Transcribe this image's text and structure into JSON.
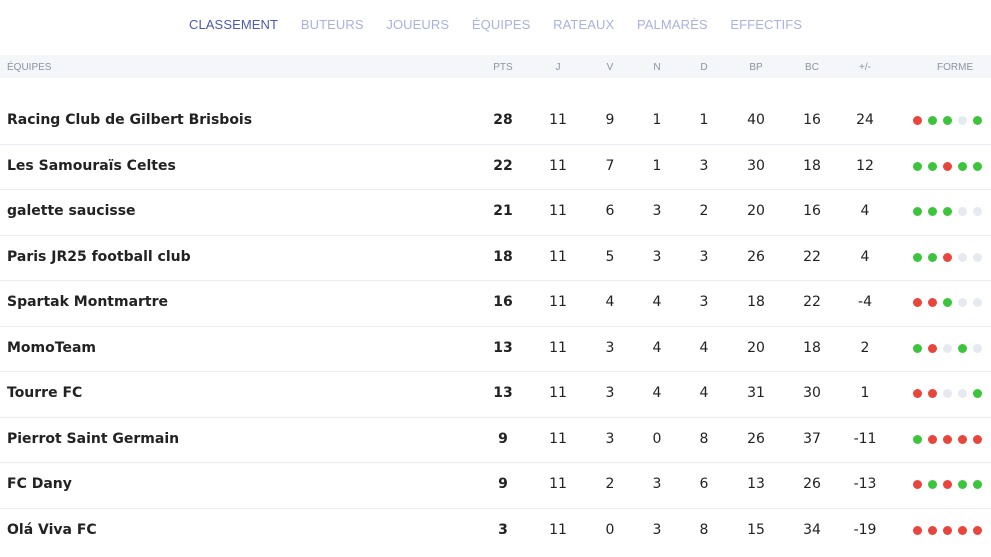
{
  "tabs": [
    "CLASSEMENT",
    "BUTEURS",
    "JOUEURS",
    "ÉQUIPES",
    "RATEAUX",
    "PALMARÈS",
    "EFFECTIFS"
  ],
  "header": {
    "team": "ÉQUIPES",
    "pts": "PTS",
    "j": "J",
    "v": "V",
    "n": "N",
    "d": "D",
    "bp": "BP",
    "bc": "BC",
    "gd": "+/-",
    "form": "FORME"
  },
  "rows": [
    {
      "team": "Racing Club de Gilbert Brisbois",
      "pts": "28",
      "j": "11",
      "v": "9",
      "n": "1",
      "d": "1",
      "bp": "40",
      "bc": "16",
      "gd": "24",
      "form": [
        "L",
        "W",
        "W",
        "N",
        "W"
      ]
    },
    {
      "team": "Les Samouraïs Celtes",
      "pts": "22",
      "j": "11",
      "v": "7",
      "n": "1",
      "d": "3",
      "bp": "30",
      "bc": "18",
      "gd": "12",
      "form": [
        "W",
        "W",
        "L",
        "W",
        "W"
      ]
    },
    {
      "team": "galette saucisse",
      "pts": "21",
      "j": "11",
      "v": "6",
      "n": "3",
      "d": "2",
      "bp": "20",
      "bc": "16",
      "gd": "4",
      "form": [
        "W",
        "W",
        "W",
        "N",
        "N"
      ]
    },
    {
      "team": "Paris JR25 football club",
      "pts": "18",
      "j": "11",
      "v": "5",
      "n": "3",
      "d": "3",
      "bp": "26",
      "bc": "22",
      "gd": "4",
      "form": [
        "W",
        "W",
        "L",
        "N",
        "N"
      ]
    },
    {
      "team": "Spartak Montmartre",
      "pts": "16",
      "j": "11",
      "v": "4",
      "n": "4",
      "d": "3",
      "bp": "18",
      "bc": "22",
      "gd": "-4",
      "form": [
        "L",
        "L",
        "W",
        "N",
        "N"
      ]
    },
    {
      "team": "MomoTeam",
      "pts": "13",
      "j": "11",
      "v": "3",
      "n": "4",
      "d": "4",
      "bp": "20",
      "bc": "18",
      "gd": "2",
      "form": [
        "W",
        "L",
        "N",
        "W",
        "N"
      ]
    },
    {
      "team": "Tourre FC",
      "pts": "13",
      "j": "11",
      "v": "3",
      "n": "4",
      "d": "4",
      "bp": "31",
      "bc": "30",
      "gd": "1",
      "form": [
        "L",
        "L",
        "N",
        "N",
        "W"
      ]
    },
    {
      "team": "Pierrot Saint Germain",
      "pts": "9",
      "j": "11",
      "v": "3",
      "n": "0",
      "d": "8",
      "bp": "26",
      "bc": "37",
      "gd": "-11",
      "form": [
        "W",
        "L",
        "L",
        "L",
        "L"
      ]
    },
    {
      "team": "FC Dany",
      "pts": "9",
      "j": "11",
      "v": "2",
      "n": "3",
      "d": "6",
      "bp": "13",
      "bc": "26",
      "gd": "-13",
      "form": [
        "L",
        "W",
        "L",
        "W",
        "W"
      ]
    },
    {
      "team": "Olá Viva FC",
      "pts": "3",
      "j": "11",
      "v": "0",
      "n": "3",
      "d": "8",
      "bp": "15",
      "bc": "34",
      "gd": "-19",
      "form": [
        "L",
        "L",
        "L",
        "L",
        "L"
      ]
    }
  ]
}
